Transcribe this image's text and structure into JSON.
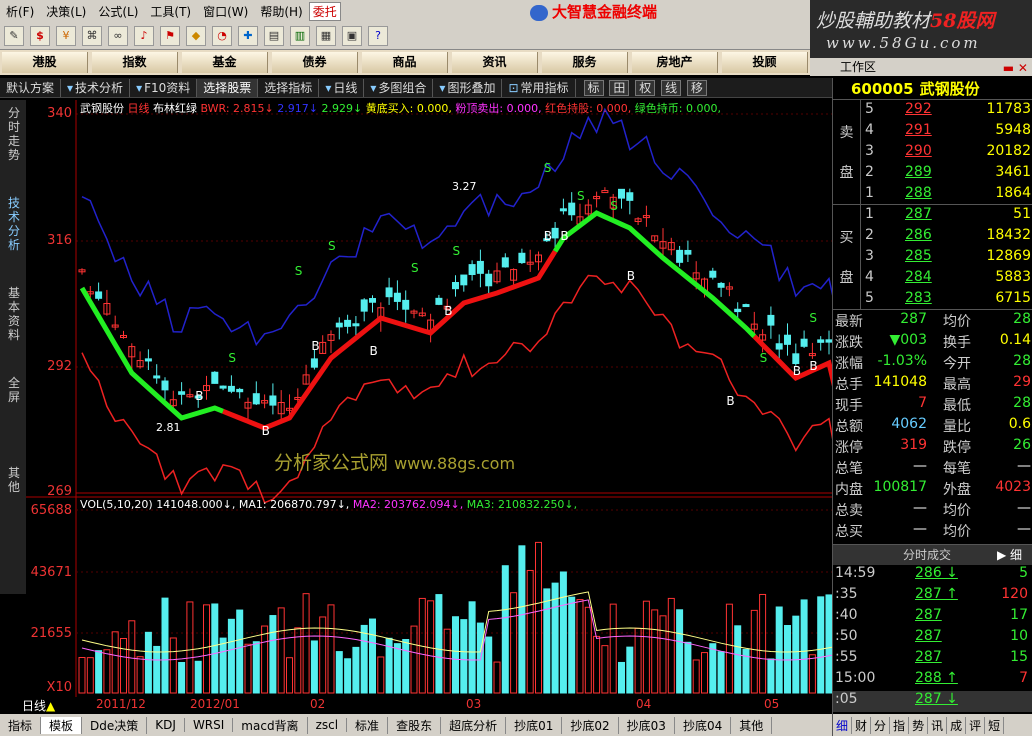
{
  "menu": {
    "items": [
      "析(F)",
      "决策(L)",
      "公式(L)",
      "工具(T)",
      "窗口(W)",
      "帮助(H)"
    ],
    "entrust": "委托"
  },
  "title": {
    "brand": "大智慧金融终端"
  },
  "watermark": {
    "line1a": "炒股輔助教材",
    "line1b": "58股网",
    "line2": "www.58Gu.com"
  },
  "toolbar": {
    "icons": [
      "pen-icon",
      "dollar-icon",
      "rmb-icon",
      "network-icon",
      "binoculars-icon",
      "bell-icon",
      "flag-icon",
      "diamond-icon",
      "pie-icon",
      "f10-icon",
      "news-icon",
      "book-icon",
      "window-icon",
      "calendar-icon",
      "help-icon"
    ]
  },
  "nav": {
    "items": [
      "港股",
      "指数",
      "基金",
      "债券",
      "商品",
      "资讯",
      "服务",
      "房地产",
      "投顾"
    ]
  },
  "workarea": {
    "label": "工作区"
  },
  "chartbar": {
    "items": [
      "默认方案",
      "技术分析",
      "F10资料",
      "选择股票",
      "选择指标",
      "日线",
      "多图组合",
      "图形叠加",
      "常用指标"
    ],
    "tags": [
      "标",
      "田",
      "权",
      "线",
      "移"
    ]
  },
  "leftside": {
    "items": [
      "分时走势",
      "技术分析",
      "基本资料",
      "全屏",
      "其他"
    ]
  },
  "indicator": {
    "stock": "武钢股份",
    "period": "日线",
    "method": "布林红绿",
    "bwr": "BWR: 2.815↓",
    "b2": "2.917↓",
    "b3": "2.929↓",
    "buy": "黄底买入: 0.000,",
    "sell": "粉顶卖出: 0.000,",
    "red": "红色持股: 0.000,",
    "green": "绿色持币: 0.000,"
  },
  "volbar": {
    "label": "VOL(5,10,20)",
    "v": "141048.000↓,",
    "ma1": "MA1: 206870.797↓,",
    "ma2": "MA2: 203762.094↓,",
    "ma3": "MA3: 210832.250↓,"
  },
  "axis": {
    "price": [
      "340",
      "316",
      "292",
      "269"
    ],
    "volume": [
      "65688",
      "43671",
      "21655"
    ],
    "x": [
      "2011/12",
      "2012/01",
      "02",
      "03",
      "04",
      "05"
    ],
    "unit": "X10",
    "day": "日线"
  },
  "annotations": {
    "high": "3.27",
    "low": "2.81"
  },
  "chartwm": {
    "a": "分析家公式网",
    "b": "www.88gs.com"
  },
  "bottomtabs": {
    "items": [
      "指标",
      "模板",
      "Dde决策",
      "KDJ",
      "WRSI",
      "macd背离",
      "zscl",
      "标准",
      "查股东",
      "超底分析",
      "抄底01",
      "抄底02",
      "抄底03",
      "抄底04",
      "其他"
    ]
  },
  "right": {
    "code": "600005",
    "name": "武钢股份",
    "ask_label": [
      "卖",
      "盘"
    ],
    "bid_label": [
      "买",
      "盘"
    ],
    "asks": [
      {
        "lv": "5",
        "p": "292",
        "v": "11783"
      },
      {
        "lv": "4",
        "p": "291",
        "v": "5948"
      },
      {
        "lv": "3",
        "p": "290",
        "v": "20182"
      },
      {
        "lv": "2",
        "p": "289",
        "v": "3461"
      },
      {
        "lv": "1",
        "p": "288",
        "v": "1864"
      }
    ],
    "bids": [
      {
        "lv": "1",
        "p": "287",
        "v": "51"
      },
      {
        "lv": "2",
        "p": "286",
        "v": "18432"
      },
      {
        "lv": "3",
        "p": "285",
        "v": "12869"
      },
      {
        "lv": "4",
        "p": "284",
        "v": "5883"
      },
      {
        "lv": "5",
        "p": "283",
        "v": "6715"
      }
    ],
    "stats": [
      {
        "k1": "最新",
        "v1": "287",
        "c1": "dn",
        "k2": "均价",
        "v2": "28",
        "c2": "dn"
      },
      {
        "k1": "涨跌",
        "v1": "▼003",
        "c1": "dn",
        "k2": "换手",
        "v2": "0.14",
        "c2": "yw"
      },
      {
        "k1": "涨幅",
        "v1": "-1.03%",
        "c1": "dn",
        "k2": "今开",
        "v2": "28",
        "c2": "dn"
      },
      {
        "k1": "总手",
        "v1": "141048",
        "c1": "yw",
        "k2": "最高",
        "v2": "29",
        "c2": "up"
      },
      {
        "k1": "现手",
        "v1": "7",
        "c1": "up",
        "k2": "最低",
        "v2": "28",
        "c2": "dn"
      },
      {
        "k1": "总额",
        "v1": "4062",
        "c1": "cy",
        "k2": "量比",
        "v2": "0.6",
        "c2": "yw"
      },
      {
        "k1": "涨停",
        "v1": "319",
        "c1": "up",
        "k2": "跌停",
        "v2": "26",
        "c2": "dn"
      },
      {
        "k1": "总笔",
        "v1": "—",
        "c1": "wh",
        "k2": "每笔",
        "v2": "—",
        "c2": "wh"
      },
      {
        "k1": "内盘",
        "v1": "100817",
        "c1": "dn",
        "k2": "外盘",
        "v2": "4023",
        "c2": "up"
      },
      {
        "k1": "总卖",
        "v1": "—",
        "c1": "wh",
        "k2": "均价",
        "v2": "—",
        "c2": "wh"
      },
      {
        "k1": "总买",
        "v1": "—",
        "c1": "wh",
        "k2": "均价",
        "v2": "—",
        "c2": "wh"
      }
    ],
    "ticks_header": "分时成交",
    "ticks_more": "细",
    "ticks": [
      {
        "t": "14:59",
        "p": "286",
        "a": "↓",
        "v": "5",
        "c": "dn",
        "vc": "dn"
      },
      {
        "t": ":35",
        "p": "287",
        "a": "↑",
        "v": "120",
        "c": "dn",
        "vc": "up"
      },
      {
        "t": ":40",
        "p": "287",
        "a": "",
        "v": "17",
        "c": "dn",
        "vc": "dn"
      },
      {
        "t": ":50",
        "p": "287",
        "a": "",
        "v": "10",
        "c": "dn",
        "vc": "dn"
      },
      {
        "t": ":55",
        "p": "287",
        "a": "",
        "v": "15",
        "c": "dn",
        "vc": "dn"
      },
      {
        "t": "15:00",
        "p": "288",
        "a": "↑",
        "v": "7",
        "c": "dn",
        "vc": "up"
      },
      {
        "t": ":05",
        "p": "287",
        "a": "↓",
        "v": "",
        "c": "dn",
        "vc": "dn"
      }
    ],
    "rtabs": [
      "细",
      "财",
      "分",
      "指",
      "势",
      "讯",
      "成",
      "评",
      "短"
    ]
  }
}
